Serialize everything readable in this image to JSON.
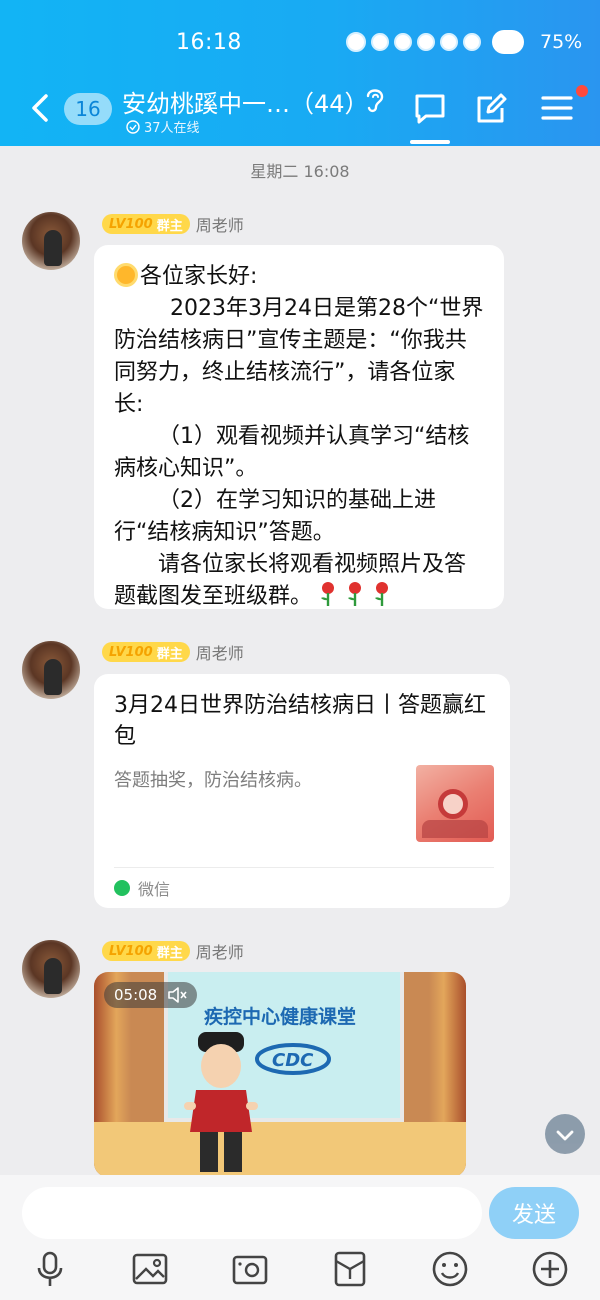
{
  "status_bar": {
    "time": "16:18",
    "battery": "75%"
  },
  "header": {
    "unread_count": "16",
    "chat_title": "安幼桃蹊中一…（44）",
    "online_status": "37人在线"
  },
  "chat": {
    "timestamp": "星期二 16:08",
    "messages": [
      {
        "badge_level": "LV100",
        "badge_role": "群主",
        "sender": "周老师",
        "lines": [
          "各位家长好:",
          "2023年3月24日是第28个“世界防治结核病日”宣传主题是：“你我共同努力，终止结核流行”，请各位家长:",
          "（1）观看视频并认真学习“结核病核心知识”。",
          "（2）在学习知识的基础上进行“结核病知识”答题。",
          "请各位家长将观看视频照片及答题截图发至班级群。"
        ]
      },
      {
        "badge_level": "LV100",
        "badge_role": "群主",
        "sender": "周老师",
        "card_title": "3月24日世界防治结核病日丨答题赢红包",
        "card_desc": "答题抽奖，防治结核病。",
        "card_source": "微信"
      },
      {
        "badge_level": "LV100",
        "badge_role": "群主",
        "sender": "周老师",
        "video_duration": "05:08",
        "video_title": "疾控中心健康课堂"
      }
    ]
  },
  "input": {
    "placeholder": "",
    "send_label": "发送"
  },
  "icons": {
    "back": "chevron-left-icon",
    "ear": "ear-icon",
    "chat": "chat-bubble-icon",
    "edit": "edit-icon",
    "menu": "menu-icon",
    "tools": [
      "mic-icon",
      "image-icon",
      "camera-icon",
      "red-packet-icon",
      "emoji-icon",
      "plus-icon"
    ]
  },
  "colors": {
    "header_start": "#12b4f5",
    "header_end": "#2a95f0",
    "send_button": "#8fd0f7",
    "badge": "#ffd84a"
  }
}
